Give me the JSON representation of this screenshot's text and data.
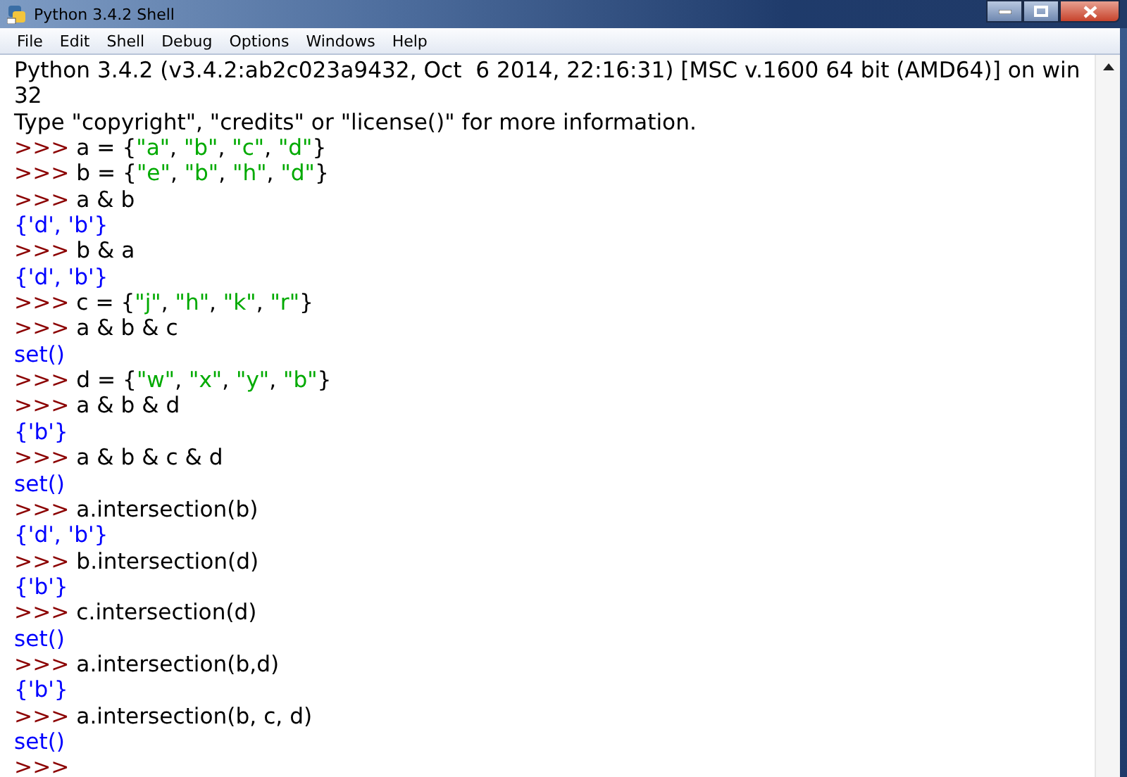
{
  "window": {
    "title": "Python 3.4.2 Shell"
  },
  "menu": [
    "File",
    "Edit",
    "Shell",
    "Debug",
    "Options",
    "Windows",
    "Help"
  ],
  "lines": [
    {
      "kind": "banner",
      "text": "Python 3.4.2 (v3.4.2:ab2c023a9432, Oct  6 2014, 22:16:31) [MSC v.1600 64 bit (AMD64)] on win"
    },
    {
      "kind": "banner",
      "text": "32"
    },
    {
      "kind": "banner",
      "text": "Type \"copyright\", \"credits\" or \"license()\" for more information."
    },
    {
      "kind": "input",
      "prompt": ">>>",
      "parts": [
        {
          "kind": "code",
          "text": "a = {"
        },
        {
          "kind": "string",
          "text": "\"a\""
        },
        {
          "kind": "code",
          "text": ", "
        },
        {
          "kind": "string",
          "text": "\"b\""
        },
        {
          "kind": "code",
          "text": ", "
        },
        {
          "kind": "string",
          "text": "\"c\""
        },
        {
          "kind": "code",
          "text": ", "
        },
        {
          "kind": "string",
          "text": "\"d\""
        },
        {
          "kind": "code",
          "text": "}"
        }
      ]
    },
    {
      "kind": "input",
      "prompt": ">>>",
      "parts": [
        {
          "kind": "code",
          "text": "b = {"
        },
        {
          "kind": "string",
          "text": "\"e\""
        },
        {
          "kind": "code",
          "text": ", "
        },
        {
          "kind": "string",
          "text": "\"b\""
        },
        {
          "kind": "code",
          "text": ", "
        },
        {
          "kind": "string",
          "text": "\"h\""
        },
        {
          "kind": "code",
          "text": ", "
        },
        {
          "kind": "string",
          "text": "\"d\""
        },
        {
          "kind": "code",
          "text": "}"
        }
      ]
    },
    {
      "kind": "input",
      "prompt": ">>>",
      "parts": [
        {
          "kind": "code",
          "text": "a & b"
        }
      ]
    },
    {
      "kind": "output",
      "text": "{'d', 'b'}"
    },
    {
      "kind": "input",
      "prompt": ">>>",
      "parts": [
        {
          "kind": "code",
          "text": "b & a"
        }
      ]
    },
    {
      "kind": "output",
      "text": "{'d', 'b'}"
    },
    {
      "kind": "input",
      "prompt": ">>>",
      "parts": [
        {
          "kind": "code",
          "text": "c = {"
        },
        {
          "kind": "string",
          "text": "\"j\""
        },
        {
          "kind": "code",
          "text": ", "
        },
        {
          "kind": "string",
          "text": "\"h\""
        },
        {
          "kind": "code",
          "text": ", "
        },
        {
          "kind": "string",
          "text": "\"k\""
        },
        {
          "kind": "code",
          "text": ", "
        },
        {
          "kind": "string",
          "text": "\"r\""
        },
        {
          "kind": "code",
          "text": "}"
        }
      ]
    },
    {
      "kind": "input",
      "prompt": ">>>",
      "parts": [
        {
          "kind": "code",
          "text": "a & b & c"
        }
      ]
    },
    {
      "kind": "output",
      "text": "set()"
    },
    {
      "kind": "input",
      "prompt": ">>>",
      "parts": [
        {
          "kind": "code",
          "text": "d = {"
        },
        {
          "kind": "string",
          "text": "\"w\""
        },
        {
          "kind": "code",
          "text": ", "
        },
        {
          "kind": "string",
          "text": "\"x\""
        },
        {
          "kind": "code",
          "text": ", "
        },
        {
          "kind": "string",
          "text": "\"y\""
        },
        {
          "kind": "code",
          "text": ", "
        },
        {
          "kind": "string",
          "text": "\"b\""
        },
        {
          "kind": "code",
          "text": "}"
        }
      ]
    },
    {
      "kind": "input",
      "prompt": ">>>",
      "parts": [
        {
          "kind": "code",
          "text": "a & b & d"
        }
      ]
    },
    {
      "kind": "output",
      "text": "{'b'}"
    },
    {
      "kind": "input",
      "prompt": ">>>",
      "parts": [
        {
          "kind": "code",
          "text": "a & b & c & d"
        }
      ]
    },
    {
      "kind": "output",
      "text": "set()"
    },
    {
      "kind": "input",
      "prompt": ">>>",
      "parts": [
        {
          "kind": "code",
          "text": "a.intersection(b)"
        }
      ]
    },
    {
      "kind": "output",
      "text": "{'d', 'b'}"
    },
    {
      "kind": "input",
      "prompt": ">>>",
      "parts": [
        {
          "kind": "code",
          "text": "b.intersection(d)"
        }
      ]
    },
    {
      "kind": "output",
      "text": "{'b'}"
    },
    {
      "kind": "input",
      "prompt": ">>>",
      "parts": [
        {
          "kind": "code",
          "text": "c.intersection(d)"
        }
      ]
    },
    {
      "kind": "output",
      "text": "set()"
    },
    {
      "kind": "input",
      "prompt": ">>>",
      "parts": [
        {
          "kind": "code",
          "text": "a.intersection(b,d)"
        }
      ]
    },
    {
      "kind": "output",
      "text": "{'b'}"
    },
    {
      "kind": "input",
      "prompt": ">>>",
      "parts": [
        {
          "kind": "code",
          "text": "a.intersection(b, c, d)"
        }
      ]
    },
    {
      "kind": "output",
      "text": "set()"
    },
    {
      "kind": "input",
      "prompt": ">>>"
    }
  ]
}
